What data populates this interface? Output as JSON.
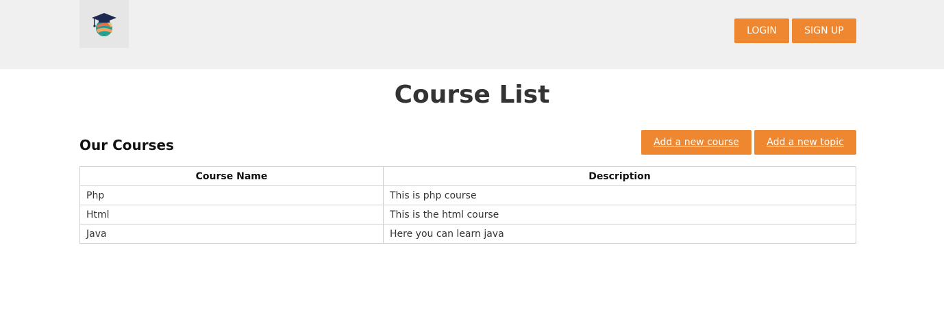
{
  "header": {
    "login_label": "LOGIN",
    "signup_label": "SIGN UP"
  },
  "main": {
    "title": "Course List",
    "section_title": "Our Courses",
    "add_course_label": "Add a new course",
    "add_topic_label": "Add a new topic"
  },
  "table": {
    "headers": [
      "Course Name",
      "Description"
    ],
    "rows": [
      {
        "name": "Php",
        "description": "This is php course"
      },
      {
        "name": "Html",
        "description": "This is the html course"
      },
      {
        "name": "Java",
        "description": "Here you can learn java"
      }
    ]
  },
  "colors": {
    "accent": "#ef8731",
    "header_bg": "#f0f0f0",
    "logo_bg": "#e6e6e6"
  },
  "icons": {
    "logo": "graduation-globe-logo-icon"
  }
}
